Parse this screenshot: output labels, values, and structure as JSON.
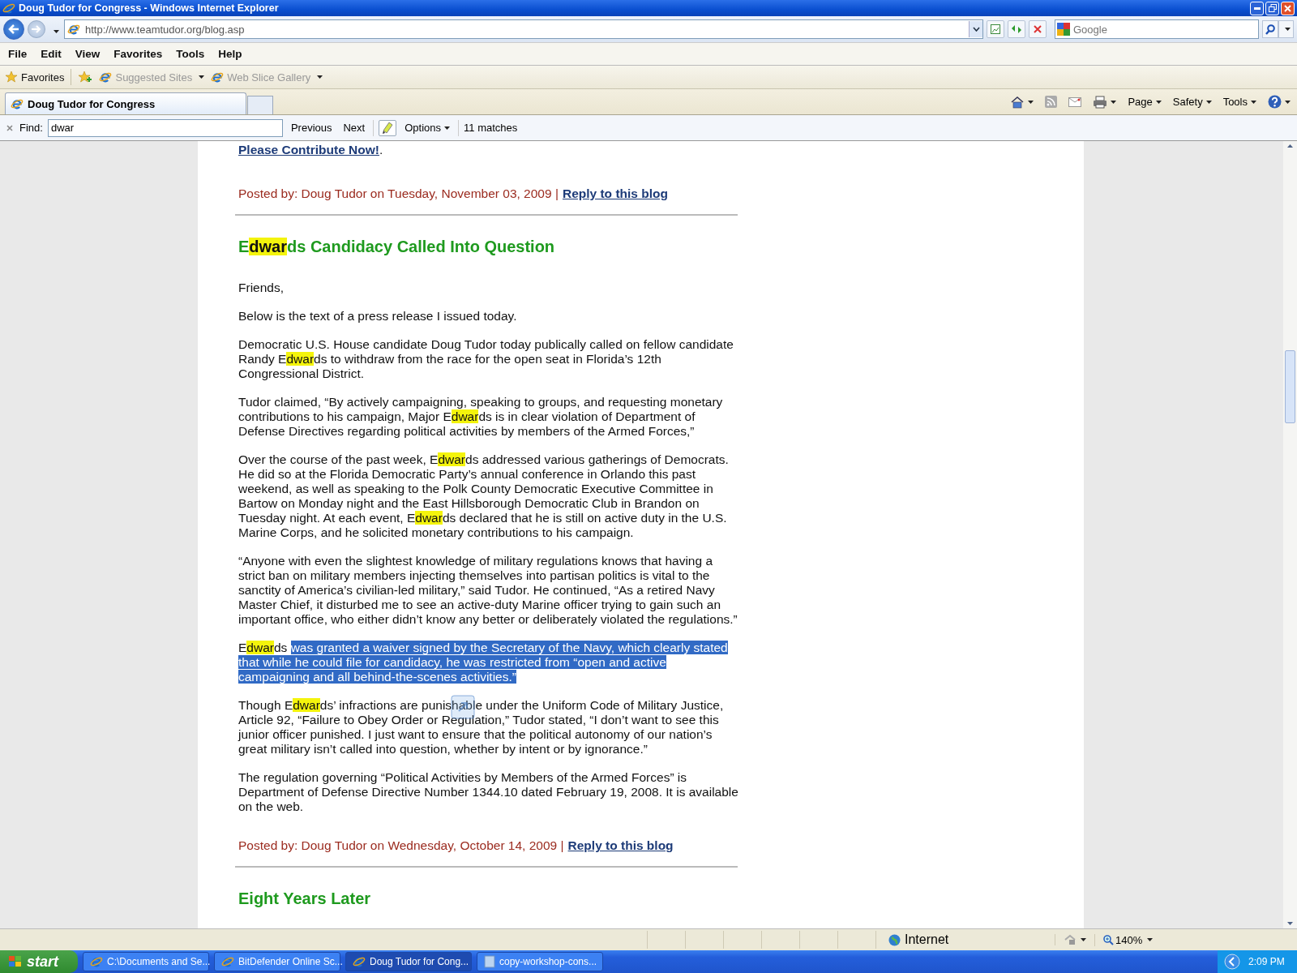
{
  "window": {
    "title": "Doug Tudor for Congress - Windows Internet Explorer"
  },
  "address": {
    "url": "http://www.teamtudor.org/blog.asp",
    "search_placeholder": "Google"
  },
  "menu": [
    "File",
    "Edit",
    "View",
    "Favorites",
    "Tools",
    "Help"
  ],
  "favorites_bar": [
    {
      "label": "Favorites",
      "disabled": false,
      "dropdown": false
    },
    {
      "label": "Suggested Sites",
      "disabled": true,
      "dropdown": true
    },
    {
      "label": "Web Slice Gallery",
      "disabled": true,
      "dropdown": true
    }
  ],
  "tabs": [
    {
      "label": "Doug Tudor for Congress",
      "selected": true
    }
  ],
  "command_bar": [
    "Page",
    "Safety",
    "Tools"
  ],
  "find_bar": {
    "label": "Find:",
    "value": "dwar",
    "previous": "Previous",
    "next": "Next",
    "options": "Options",
    "matches": "11 matches"
  },
  "blog": {
    "contribute": {
      "link": "Please Contribute Now!",
      "suffix": "."
    },
    "first_footer": {
      "posted": "Posted by: Doug Tudor on Tuesday, November 03, 2009 |",
      "reply": "Reply to this blog"
    },
    "article": {
      "title": [
        {
          "text": "E",
          "kind": "plain"
        },
        {
          "text": "dwar",
          "kind": "match"
        },
        {
          "text": "ds Candidacy Called Into Question",
          "kind": "plain"
        }
      ],
      "paragraphs": [
        [
          {
            "text": "Friends,",
            "kind": "plain"
          }
        ],
        [
          {
            "text": "Below is the text of a press release I issued today.",
            "kind": "plain"
          }
        ],
        [
          {
            "text": "Democratic U.S. House candidate Doug Tudor today publically called on fellow candidate Randy E",
            "kind": "plain"
          },
          {
            "text": "dwar",
            "kind": "match"
          },
          {
            "text": "ds to withdraw from the race for the open seat in Florida’s 12th Congressional District.",
            "kind": "plain"
          }
        ],
        [
          {
            "text": "Tudor claimed, “By actively campaigning, speaking to groups, and requesting monetary contributions to his campaign, Major E",
            "kind": "plain"
          },
          {
            "text": "dwar",
            "kind": "match"
          },
          {
            "text": "ds is in clear violation of Department of Defense Directives regarding political activities by members of the Armed Forces,”",
            "kind": "plain"
          }
        ],
        [
          {
            "text": "Over the course of the past week, E",
            "kind": "plain"
          },
          {
            "text": "dwar",
            "kind": "match"
          },
          {
            "text": "ds addressed various gatherings of Democrats. He did so at the Florida Democratic Party’s annual conference in Orlando this past weekend, as well as speaking to the Polk County Democratic Executive Committee in Bartow on Monday night and the East Hillsborough Democratic Club in Brandon on Tuesday night. At each event, E",
            "kind": "plain"
          },
          {
            "text": "dwar",
            "kind": "match"
          },
          {
            "text": "ds declared that he is still on active duty in the U.S. Marine Corps, and he solicited monetary contributions to his campaign.",
            "kind": "plain"
          }
        ],
        [
          {
            "text": "“Anyone with even the slightest knowledge of military regulations knows that having a strict ban on military members injecting themselves into partisan politics is vital to the sanctity of America’s civilian-led military,” said Tudor. He continued, “As a retired Navy Master Chief, it disturbed me to see an active-duty Marine officer trying to gain such an important office, who either didn’t know any better or deliberately violated the regulations.”",
            "kind": "plain"
          }
        ],
        [
          {
            "text": "E",
            "kind": "plain"
          },
          {
            "text": "dwar",
            "kind": "match"
          },
          {
            "text": "ds ",
            "kind": "plain"
          },
          {
            "text": "was granted a waiver signed by the Secretary of the Navy, which clearly stated that while he could file for candidacy, he was restricted from “open and active campaigning and all behind-the-scenes activities.”",
            "kind": "selection"
          }
        ],
        [
          {
            "text": "Though E",
            "kind": "plain"
          },
          {
            "text": "dwar",
            "kind": "match"
          },
          {
            "text": "ds’ infractions are punishable under the Uniform Code of Military Justice, Article 92, “Failure to Obey Order or Regulation,” Tudor stated, “I don’t want to see this junior officer punished. I just want to ensure that the political autonomy of our nation’s great military isn’t called into question, whether by intent or by ignorance.”",
            "kind": "plain"
          }
        ],
        [
          {
            "text": "The regulation governing “Political Activities by Members of the Armed Forces” is Department of Defense Directive Number 1344.10 dated February 19, 2008. It is available on the web.",
            "kind": "plain"
          }
        ]
      ],
      "footer": {
        "posted": "Posted by: Doug Tudor on Wednesday, October 14, 2009 |",
        "reply": "Reply to this blog"
      }
    },
    "next_title": "Eight Years Later"
  },
  "status_bar": {
    "zone": "Internet",
    "zoom": "140%"
  },
  "taskbar": {
    "start": "start",
    "items": [
      {
        "label": "C:\\Documents and Se...",
        "kind": "folder",
        "selected": false
      },
      {
        "label": "BitDefender Online Sc...",
        "kind": "browser",
        "selected": false
      },
      {
        "label": "Doug Tudor for Cong...",
        "kind": "browser",
        "selected": true
      },
      {
        "label": "copy-workshop-cons...",
        "kind": "document",
        "selected": false
      }
    ],
    "clock": "2:09 PM"
  }
}
